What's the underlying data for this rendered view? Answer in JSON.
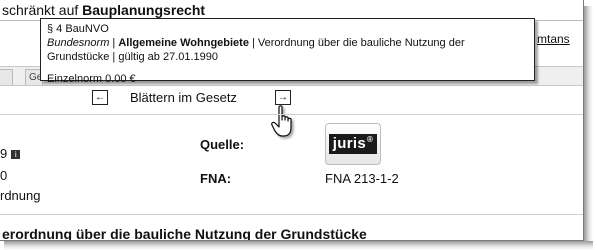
{
  "header": {
    "prefix": "schränkt auf ",
    "bold": "Bauplanungsrecht"
  },
  "right_link": "mtans",
  "tabs": [
    "",
    "Ge"
  ],
  "nav": {
    "prev_glyph": "←",
    "label": "Blättern im Gesetz",
    "next_glyph": "→"
  },
  "tooltip": {
    "title": "§ 4 BauNVO",
    "kind": "Bundesnorm",
    "separator": " | ",
    "heading": "Allgemeine Wohngebiete",
    "desc1": " | Verordnung über die bauliche Nutzung der",
    "desc2": "Grundstücke | gültig ab 27.01.1990",
    "footer": "Einzelnorm 0.00 €"
  },
  "left_fragments": {
    "a": "9",
    "b": "0",
    "c": "rdnung"
  },
  "fields": {
    "quelle_label": "Quelle:",
    "fna_label": "FNA:",
    "fna_value": "FNA 213-1-2"
  },
  "logo": {
    "text": "juris",
    "mark": "®"
  },
  "bottom_title": "erordnung über die bauliche Nutzung der Grundstücke",
  "icons": {
    "prev": "arrow-left-icon",
    "next": "arrow-right-icon",
    "cursor": "hand-cursor-icon",
    "info": "info-icon"
  }
}
